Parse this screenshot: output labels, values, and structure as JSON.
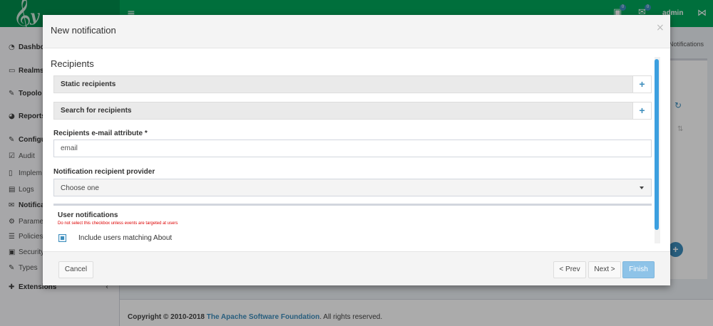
{
  "app": {
    "logo_text": "y",
    "logo_glyph": "𝄞",
    "user": "admin",
    "badges": [
      "0",
      "0"
    ]
  },
  "sidebar": {
    "items": [
      {
        "label": "Dashbo",
        "icon": "dashboard-icon",
        "glyph": "◔"
      },
      {
        "label": "Realms",
        "icon": "folder-icon",
        "glyph": "▭"
      },
      {
        "label": "Topolo",
        "icon": "wrench-icon",
        "glyph": "✎"
      },
      {
        "label": "Reports",
        "icon": "pie-chart-icon",
        "glyph": "◕"
      },
      {
        "label": "Configu",
        "icon": "edit-icon",
        "glyph": "✎"
      }
    ],
    "subitems": [
      {
        "label": "Audit",
        "icon": "check-square-icon",
        "glyph": "☑"
      },
      {
        "label": "Implem",
        "icon": "file-icon",
        "glyph": "▯"
      },
      {
        "label": "Logs",
        "icon": "file-text-icon",
        "glyph": "▤"
      },
      {
        "label": "Notifica",
        "icon": "envelope-icon",
        "glyph": "✉"
      },
      {
        "label": "Parame",
        "icon": "gear-icon",
        "glyph": "⚙"
      },
      {
        "label": "Policies",
        "icon": "list-icon",
        "glyph": "☰"
      },
      {
        "label": "Security",
        "icon": "lock-icon",
        "glyph": "▣"
      },
      {
        "label": "Types",
        "icon": "wrench-icon",
        "glyph": "✎"
      }
    ],
    "extensions": {
      "label": "Extensions",
      "icon": "puzzle-icon",
      "glyph": "✚"
    }
  },
  "background": {
    "breadcrumb": "Notifications"
  },
  "footer": {
    "copyright": "Copyright © 2010-2018 ",
    "org_link": "The Apache Software Foundation",
    "rights": ". All rights reserved."
  },
  "modal": {
    "title": "New notification",
    "section_title": "Recipients",
    "static_recipients": "Static recipients",
    "search_recipients": "Search for recipients",
    "email_attr_label": "Recipients e-mail attribute",
    "email_attr_required": "*",
    "email_attr_value": "email",
    "provider_label": "Notification recipient provider",
    "provider_value": "Choose one",
    "user_notifications_title": "User notifications",
    "user_notifications_warning": "Do not select this checkbox unless events are targeted at users",
    "include_users_label": "Include users matching About",
    "buttons": {
      "cancel": "Cancel",
      "prev": "< Prev",
      "next": "Next >",
      "finish": "Finish"
    }
  }
}
